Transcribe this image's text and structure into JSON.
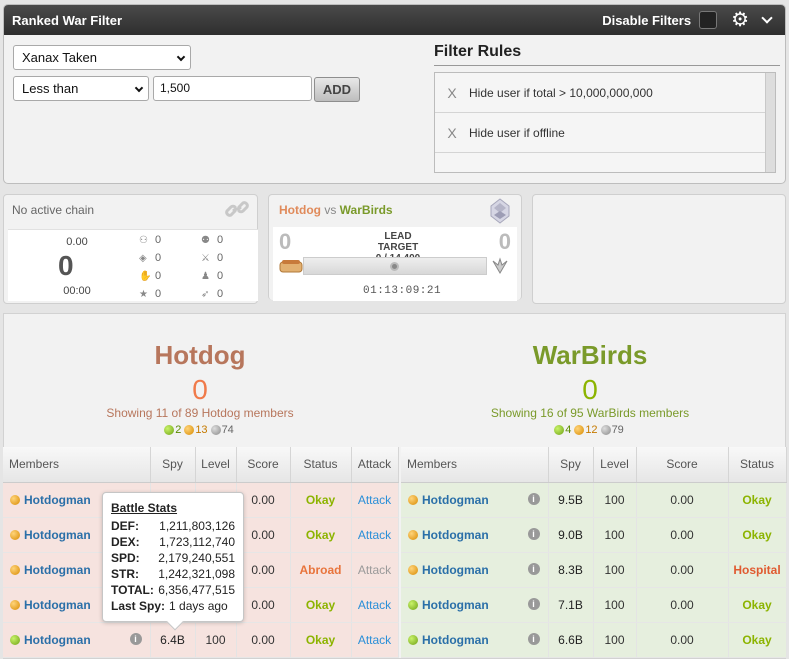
{
  "filter_panel": {
    "title": "Ranked War Filter",
    "disable_label": "Disable Filters",
    "stat_select": "Xanax Taken",
    "comparison_select": "Less than",
    "value_input": "1,500",
    "add_label": "ADD",
    "rules_title": "Filter Rules",
    "rules": [
      {
        "x": "X",
        "text": "Hide user if total > 10,000,000,000"
      },
      {
        "x": "X",
        "text": "Hide user if offline"
      }
    ]
  },
  "chain": {
    "title": "No active chain",
    "value_top": "0.00",
    "value_big": "0",
    "value_time": "00:00",
    "stats": [
      "0",
      "0",
      "0",
      "0",
      "0",
      "0",
      "0",
      "0"
    ]
  },
  "lead": {
    "faction_a": "Hotdog",
    "vs": "vs",
    "faction_b": "WarBirds",
    "score_a": "0",
    "score_b": "0",
    "label": "LEAD TARGET",
    "target": "0 / 14,400",
    "progress": 0,
    "timer": "01:13:09:21"
  },
  "factions": {
    "left": {
      "name": "Hotdog",
      "score": "0",
      "showing": "Showing 11 of 89 Hotdog members",
      "counts": {
        "green": "2",
        "orange": "13",
        "gray": "74"
      },
      "color": "#b7765c",
      "score_color": "#f07a4a"
    },
    "right": {
      "name": "WarBirds",
      "score": "0",
      "showing": "Showing 16 of 95 WarBirds members",
      "counts": {
        "green": "4",
        "orange": "12",
        "gray": "79"
      },
      "color": "#7a9a2a",
      "score_color": "#8cb400"
    }
  },
  "table_left": {
    "headers": [
      "Members",
      "Spy",
      "Level",
      "Score",
      "Status",
      "Attack"
    ],
    "rows": [
      {
        "status_dot": "orange",
        "name": "Hotdogman",
        "spy": "",
        "level": "",
        "score": "0.00",
        "status": "Okay",
        "status_class": "st-okay",
        "attack": "Attack",
        "attack_enabled": true
      },
      {
        "status_dot": "orange",
        "name": "Hotdogman",
        "spy": "",
        "level": "",
        "score": "0.00",
        "status": "Okay",
        "status_class": "st-okay",
        "attack": "Attack",
        "attack_enabled": true
      },
      {
        "status_dot": "orange",
        "name": "Hotdogman",
        "spy": "",
        "level": "",
        "score": "0.00",
        "status": "Abroad",
        "status_class": "st-abroad",
        "attack": "Attack",
        "attack_enabled": false
      },
      {
        "status_dot": "orange",
        "name": "Hotdogman",
        "spy": "",
        "level": "",
        "score": "0.00",
        "status": "Okay",
        "status_class": "st-okay",
        "attack": "Attack",
        "attack_enabled": true
      },
      {
        "status_dot": "green",
        "name": "Hotdogman",
        "spy": "6.4B",
        "level": "100",
        "score": "0.00",
        "status": "Okay",
        "status_class": "st-okay",
        "attack": "Attack",
        "attack_enabled": true
      }
    ]
  },
  "table_right": {
    "headers": [
      "Members",
      "Spy",
      "Level",
      "Score",
      "Status"
    ],
    "rows": [
      {
        "status_dot": "orange",
        "name": "Hotdogman",
        "spy": "9.5B",
        "level": "100",
        "score": "0.00",
        "status": "Okay",
        "status_class": "st-okay"
      },
      {
        "status_dot": "orange",
        "name": "Hotdogman",
        "spy": "9.0B",
        "level": "100",
        "score": "0.00",
        "status": "Okay",
        "status_class": "st-okay"
      },
      {
        "status_dot": "orange",
        "name": "Hotdogman",
        "spy": "8.3B",
        "level": "100",
        "score": "0.00",
        "status": "Hospital",
        "status_class": "st-hospital"
      },
      {
        "status_dot": "green",
        "name": "Hotdogman",
        "spy": "7.1B",
        "level": "100",
        "score": "0.00",
        "status": "Okay",
        "status_class": "st-okay"
      },
      {
        "status_dot": "green",
        "name": "Hotdogman",
        "spy": "6.6B",
        "level": "100",
        "score": "0.00",
        "status": "Okay",
        "status_class": "st-okay"
      }
    ]
  },
  "tooltip": {
    "title": "Battle Stats",
    "rows": [
      {
        "label": "DEF:",
        "value": "1,211,803,126"
      },
      {
        "label": "DEX:",
        "value": "1,723,112,740"
      },
      {
        "label": "SPD:",
        "value": "2,179,240,551"
      },
      {
        "label": "STR:",
        "value": "1,242,321,098"
      },
      {
        "label": "TOTAL:",
        "value": "6,356,477,515"
      }
    ],
    "last_spy_label": "Last Spy:",
    "last_spy_value": "1 days ago"
  }
}
